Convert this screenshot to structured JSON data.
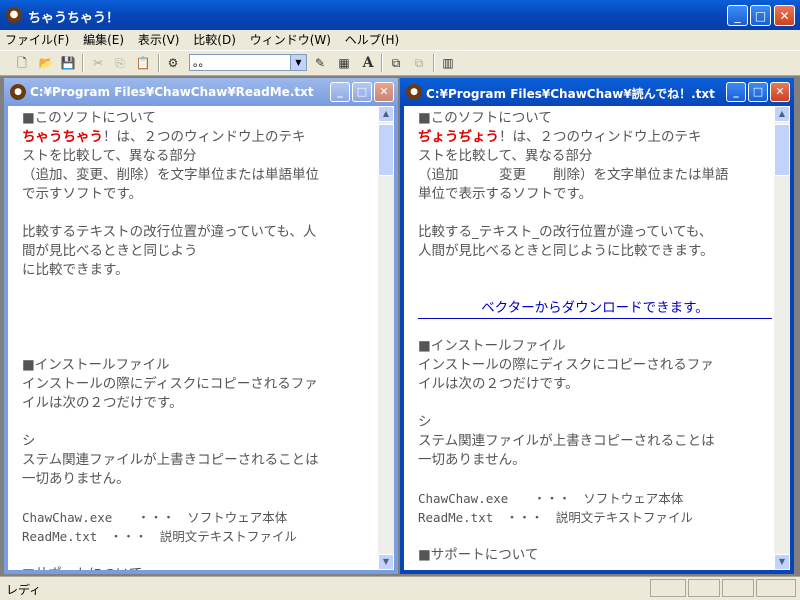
{
  "app": {
    "title": "ちゃうちゃう！"
  },
  "menu": [
    "ファイル(F)",
    "編集(E)",
    "表示(V)",
    "比較(D)",
    "ウィンドウ(W)",
    "ヘルプ(H)"
  ],
  "toolbar": {
    "combo_value": "。。"
  },
  "left_window": {
    "title": "C:¥Program Files¥ChawChaw¥ReadMe.txt",
    "lines": [
      "■このソフトについて",
      "ちゃうちゃう！は、２つのウィンドウ上のテキ",
      "ストを比較して、異なる部分",
      "（追加、変更、削除）を文字単位または単語単位",
      "で示すソフトです。",
      "",
      "比較するテキストの改行位置が違っていても、人",
      "間が見比べるときと同じよう",
      "に比較できます。",
      "",
      "",
      "",
      "",
      "■インストールファイル",
      "インストールの際にディスクにコピーされるファ",
      "イルは次の２つだけです。",
      "",
      "シ",
      "ステム関連ファイルが上書きコピーされることは",
      "一切ありません。",
      "",
      "ChawChaw.exe　　・・・　ソフトウェア本体",
      "ReadMe.txt　・・・　説明文テキストファイル",
      "",
      "■サポートについて"
    ],
    "red_word": "ちゃうちゃう"
  },
  "right_window": {
    "title": "C:¥Program Files¥ChawChaw¥読んでね！.txt",
    "lines": [
      "■このソフトについて",
      "ぢょうぢょう！は、２つのウィンドウ上のテキ",
      "ストを比較して、異なる部分",
      "（追加　　　変更　　削除）を文字単位または単語",
      "単位で表示するソフトです。",
      "",
      "比較する_テキスト_の改行位置が違っていても、",
      "人間が見比べるときと同じように比較できます。",
      "",
      "",
      "ベクターからダウンロードできます。",
      "",
      "■インストールファイル",
      "インストールの際にディスクにコピーされるファ",
      "イルは次の２つだけです。",
      "",
      "シ",
      "ステム関連ファイルが上書きコピーされることは",
      "一切ありません。",
      "",
      "ChawChaw.exe　　・・・　ソフトウェア本体",
      "ReadMe.txt　・・・　説明文テキストファイル",
      "",
      "■サポートについて"
    ],
    "red_word": "ぢょうぢょう"
  },
  "status": {
    "text": "レディ"
  },
  "colors": {
    "diff_red": "#e00000",
    "link_blue": "#0000c0",
    "title_blue": "#0846b8"
  }
}
